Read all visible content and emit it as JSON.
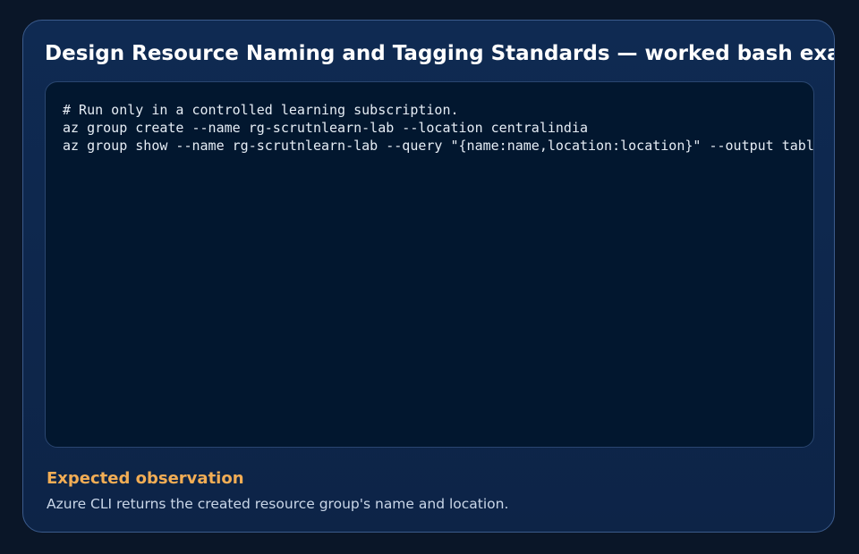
{
  "card": {
    "title": "Design Resource Naming and Tagging Standards — worked bash example"
  },
  "code": {
    "lines": [
      "# Run only in a controlled learning subscription.",
      "az group create --name rg-scrutnlearn-lab --location centralindia",
      "az group show --name rg-scrutnlearn-lab --query \"{name:name,location:location}\" --output table"
    ]
  },
  "observation": {
    "heading": "Expected observation",
    "text": "Azure CLI returns the created resource group's name and location."
  },
  "colors": {
    "page_background": "#0a1628",
    "card_background": "#0f2a52",
    "card_border": "#3b5b8c",
    "code_background": "#02172f",
    "heading_accent": "#f2ad55",
    "title_text": "#ffffff"
  }
}
